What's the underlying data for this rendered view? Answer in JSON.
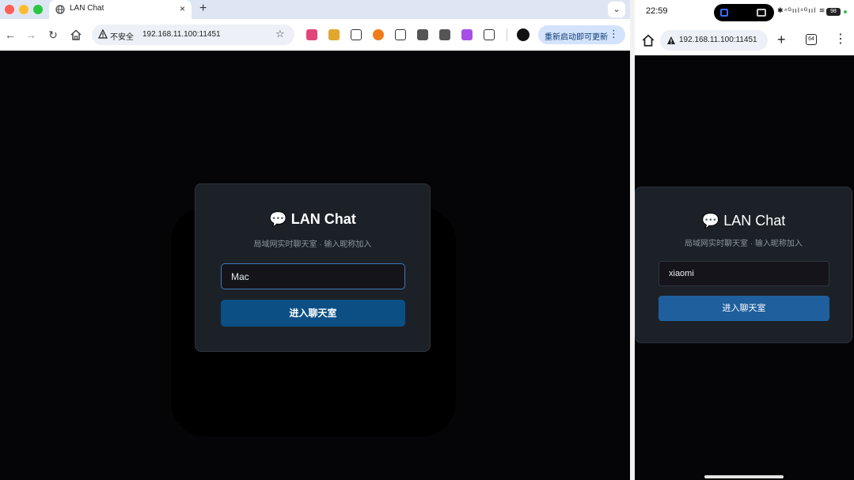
{
  "desktop": {
    "tab": {
      "title": "LAN Chat",
      "close": "×"
    },
    "new_tab": "+",
    "tab_dropdown": "⌄",
    "toolbar": {
      "back": "←",
      "forward": "→",
      "reload": "↻",
      "security_label": "不安全",
      "url": "192.168.11.100:11451",
      "bookmark": "☆",
      "update_label": "重新启动即可更新",
      "menu": "⋮"
    },
    "page": {
      "title_icon": "💬",
      "title": "LAN Chat",
      "subtitle": "局域网实时聊天室 · 输入昵称加入",
      "input_value": "Mac",
      "button_label": "进入聊天室"
    }
  },
  "phone": {
    "status": {
      "time": "22:59",
      "icons": "✱⁴ᴳııl⁴ᴳııl ≋",
      "battery": "98"
    },
    "toolbar": {
      "url": "192.168.11.100:11451",
      "new_tab": "+",
      "tab_count": "64",
      "menu": "⋮"
    },
    "page": {
      "title_icon": "💬",
      "title": "LAN Chat",
      "subtitle": "局域网实时聊天室 · 输入昵称加入",
      "input_value": "xiaomi",
      "button_label": "进入聊天室"
    }
  },
  "colors": {
    "background": "#050507",
    "card": "#1c2127",
    "button": "#0b4f85",
    "input_focus": "#3d79b7",
    "muted_text": "#8b949e"
  }
}
